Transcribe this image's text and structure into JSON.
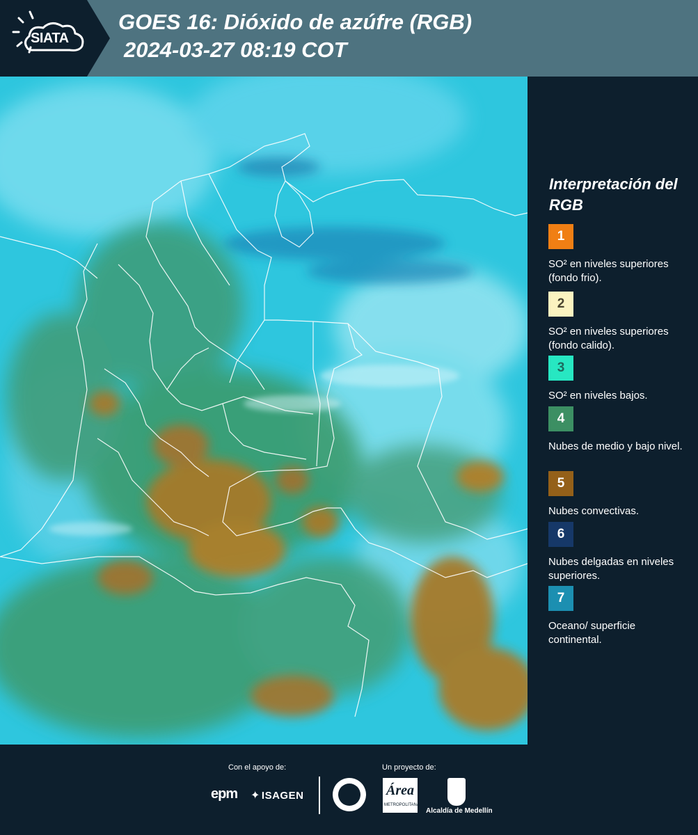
{
  "header": {
    "logo_text": "SIATA",
    "title_line1": "GOES 16: Dióxido de azúfre (RGB)",
    "title_line2": "2024-03-27 08:19 COT",
    "background": "#4e7380",
    "logo_background": "#0d1f2d"
  },
  "map": {
    "product": "GOES 16 SO2 RGB composite",
    "colors": {
      "ocean_surface": "#2ec6de",
      "mid_low_clouds": "#3a9b6e",
      "convective_clouds": "#a67a2a",
      "borders": "#ffffff"
    }
  },
  "legend": {
    "title": "Interpretación del RGB",
    "items": [
      {
        "number": "1",
        "color": "#f07f14",
        "description": "SO² en niveles superiores (fondo frio)."
      },
      {
        "number": "2",
        "color": "#fbf3c0",
        "description": "SO² en niveles superiores (fondo calido)."
      },
      {
        "number": "3",
        "color": "#27e7c2",
        "description": "SO² en niveles bajos."
      },
      {
        "number": "4",
        "color": "#3c8f63",
        "description": "Nubes de medio y bajo nivel."
      },
      {
        "number": "5",
        "color": "#946019",
        "description": "Nubes convectivas."
      },
      {
        "number": "6",
        "color": "#163868",
        "description": "Nubes delgadas en niveles superiores."
      },
      {
        "number": "7",
        "color": "#1c8fb1",
        "description": "Oceano/ superficie continental."
      }
    ]
  },
  "footer": {
    "support_label": "Con el apoyo de:",
    "project_label": "Un proyecto de:",
    "sponsors": [
      "epm",
      "ISAGEN"
    ],
    "partners": [
      "Área Metropolitana Valle de Aburrá",
      "Alcaldía de Medellín"
    ],
    "epm_text": "epm",
    "isagen_text": "ISAGEN",
    "area_text": "Área",
    "area_subtext": "METROPOLITANA",
    "alcaldia_text": "Alcaldía de Medellín"
  }
}
